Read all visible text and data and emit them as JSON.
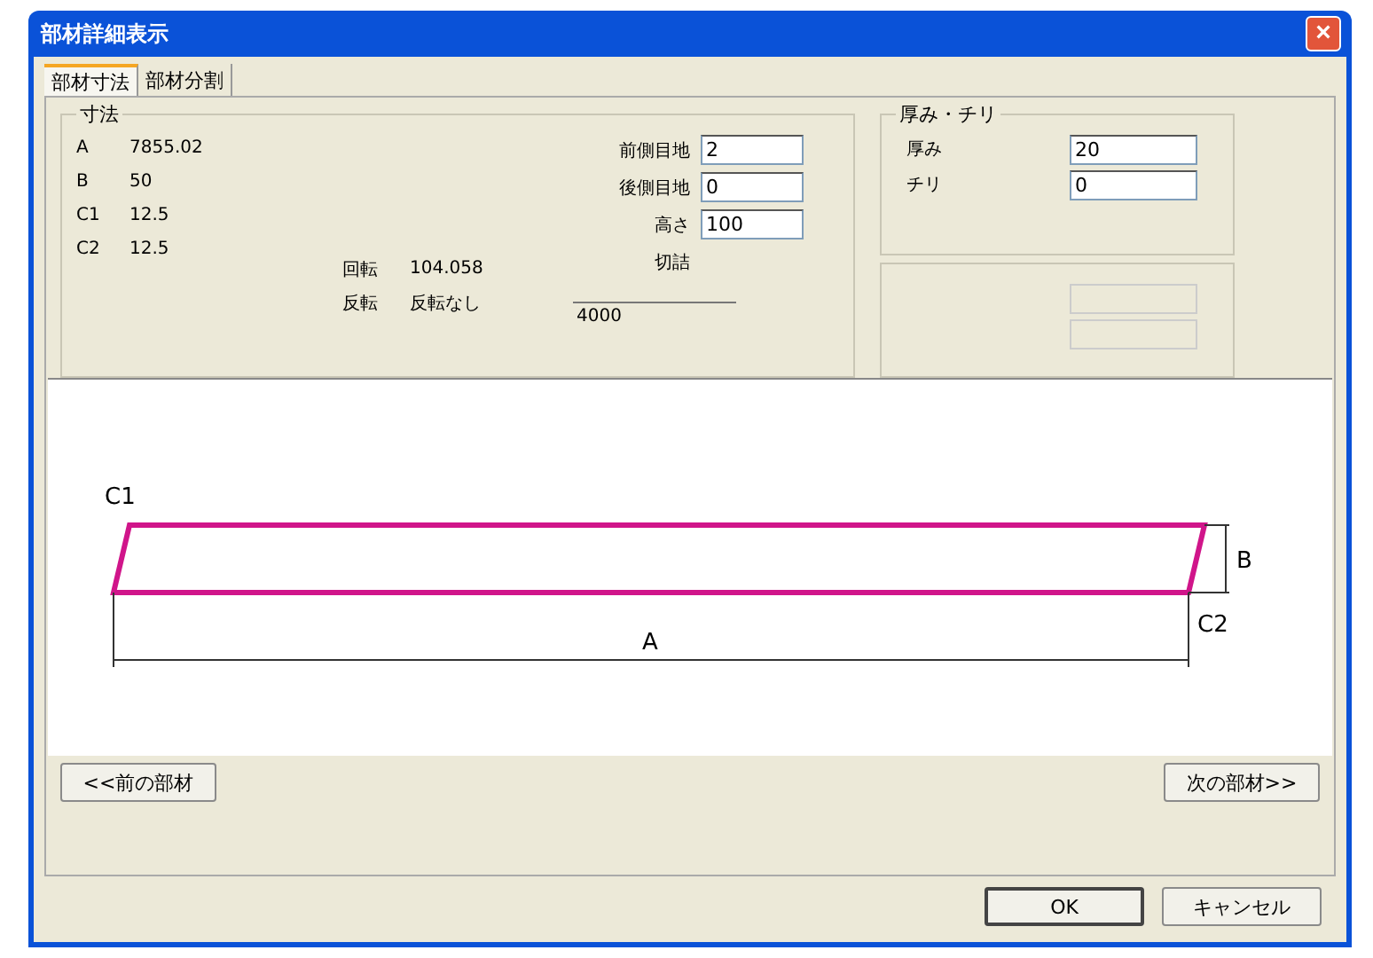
{
  "window": {
    "title": "部材詳細表示",
    "close": "×"
  },
  "tabs": [
    {
      "label": "部材寸法",
      "selected": true
    },
    {
      "label": "部材分割",
      "selected": false
    }
  ],
  "dimensions": {
    "title": "寸法",
    "values": [
      {
        "label": "A",
        "value": "7855.02"
      },
      {
        "label": "B",
        "value": "50"
      },
      {
        "label": "C1",
        "value": "12.5"
      },
      {
        "label": "C2",
        "value": "12.5"
      }
    ],
    "rotation": {
      "label": "回転",
      "value": "104.058"
    },
    "flip": {
      "label": "反転",
      "value": "反転なし"
    },
    "fields": [
      {
        "label": "前側目地",
        "value": "2"
      },
      {
        "label": "後側目地",
        "value": "0"
      },
      {
        "label": "高さ",
        "value": "100"
      }
    ],
    "trim": {
      "label": "切詰",
      "value": "4000"
    }
  },
  "thickness": {
    "title": "厚み・チリ",
    "fields": [
      {
        "label": "厚み",
        "value": "20"
      },
      {
        "label": "チリ",
        "value": "0"
      }
    ]
  },
  "disabled_group": {
    "fields": [
      {
        "disabled": true
      },
      {
        "disabled": true
      }
    ]
  },
  "drawing": {
    "labels": {
      "c1": "C1",
      "b": "B",
      "c2": "C2",
      "a": "A"
    }
  },
  "nav_buttons": [
    "<<前の部材",
    "次の部材>>"
  ],
  "buttons": [
    "OK",
    "キャンセル"
  ]
}
